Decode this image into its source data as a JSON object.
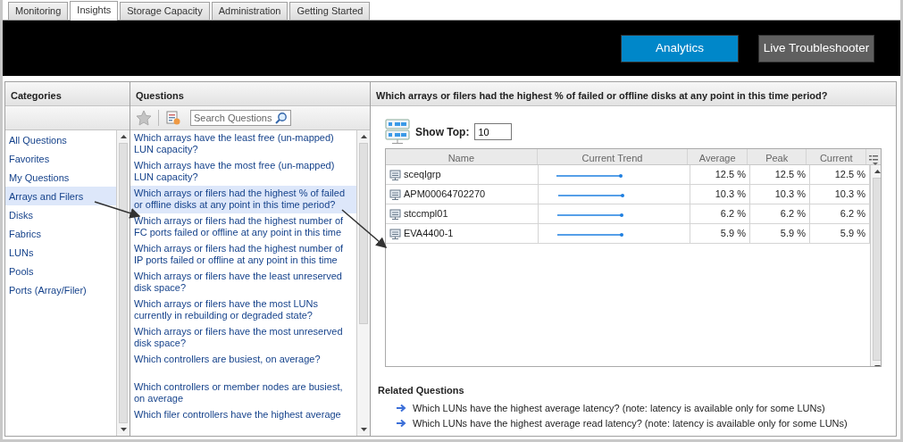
{
  "tabs": [
    {
      "label": "Monitoring",
      "selected": false
    },
    {
      "label": "Insights",
      "selected": true
    },
    {
      "label": "Storage Capacity",
      "selected": false
    },
    {
      "label": "Administration",
      "selected": false
    },
    {
      "label": "Getting Started",
      "selected": false
    }
  ],
  "header_buttons": [
    {
      "label": "Analytics",
      "selected": true
    },
    {
      "label": "Live Troubleshooter",
      "selected": false
    }
  ],
  "categories": {
    "title": "Categories",
    "items": [
      {
        "label": "All Questions",
        "selected": false
      },
      {
        "label": "Favorites",
        "selected": false
      },
      {
        "label": "My Questions",
        "selected": false
      },
      {
        "label": "Arrays and Filers",
        "selected": true
      },
      {
        "label": "Disks",
        "selected": false
      },
      {
        "label": "Fabrics",
        "selected": false
      },
      {
        "label": "LUNs",
        "selected": false
      },
      {
        "label": "Pools",
        "selected": false
      },
      {
        "label": "Ports (Array/Filer)",
        "selected": false
      }
    ]
  },
  "questions": {
    "title": "Questions",
    "search": {
      "placeholder": "Search Questions"
    },
    "items": [
      {
        "text": "Which arrays have the least free (un-mapped) LUN capacity?",
        "selected": false
      },
      {
        "text": "Which arrays have the most free (un-mapped) LUN capacity?",
        "selected": false
      },
      {
        "text": "Which arrays or filers had the highest % of failed or offline disks at any point in this time period?",
        "selected": true
      },
      {
        "text": "Which arrays or filers had the highest number of FC ports failed or offline at any point in this time",
        "selected": false
      },
      {
        "text": "Which arrays or filers had the highest number of IP ports failed or offline at any point in this time",
        "selected": false
      },
      {
        "text": "Which arrays or filers have the least unreserved disk space?",
        "selected": false
      },
      {
        "text": "Which arrays or filers have the most LUNs currently in rebuilding or degraded state?",
        "selected": false
      },
      {
        "text": "Which arrays or filers have the most unreserved disk space?",
        "selected": false
      },
      {
        "text": "Which controllers are busiest, on average?",
        "selected": false
      },
      {
        "text": "Which controllers or member nodes are busiest, on average",
        "selected": false
      },
      {
        "text": "Which filer controllers have the highest average",
        "selected": false
      }
    ]
  },
  "detail": {
    "title": "Which arrays or filers had the highest % of failed or offline disks at any point in this time period?",
    "show_top": {
      "label": "Show Top:",
      "value": "10"
    },
    "table": {
      "columns": [
        "Name",
        "Current Trend",
        "Average",
        "Peak",
        "Current"
      ],
      "rows": [
        {
          "name": "sceqlgrp",
          "average": "12.5 %",
          "peak": "12.5 %",
          "current": "12.5 %"
        },
        {
          "name": "APM00064702270",
          "average": "10.3 %",
          "peak": "10.3 %",
          "current": "10.3 %"
        },
        {
          "name": "stccmpl01",
          "average": "6.2 %",
          "peak": "6.2 %",
          "current": "6.2 %"
        },
        {
          "name": "EVA4400-1",
          "average": "5.9 %",
          "peak": "5.9 %",
          "current": "5.9 %"
        }
      ]
    },
    "related": {
      "title": "Related Questions",
      "items": [
        "Which LUNs have the highest average latency? (note: latency is available only for some LUNs)",
        "Which LUNs have the highest average read latency? (note: latency is available only for some LUNs)"
      ]
    }
  }
}
